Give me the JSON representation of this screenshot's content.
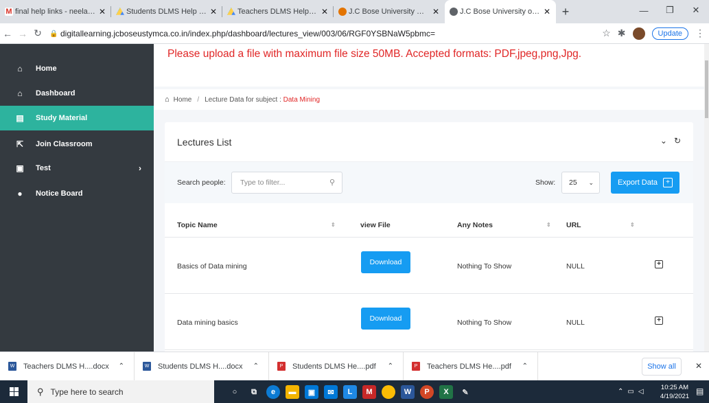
{
  "browser": {
    "tabs": [
      {
        "title": "final help links - neelam.du",
        "icon": "gmail-icon",
        "color": "#d93025"
      },
      {
        "title": "Students DLMS Help Book",
        "icon": "drive-icon",
        "color": "#1fa463"
      },
      {
        "title": "Teachers DLMS Help Book",
        "icon": "drive-icon",
        "color": "#1fa463"
      },
      {
        "title": "J.C Bose University Of Scien",
        "icon": "university-icon",
        "color": "#e37400"
      },
      {
        "title": "J.C Bose University of Scien",
        "icon": "globe-icon",
        "color": "#5f6368"
      }
    ],
    "url": "digitallearning.jcboseustymca.co.in/index.php/dashboard/lectures_view/003/06/RGF0YSBNaW5pbmc=",
    "update_label": "Update"
  },
  "sidebar": {
    "items": [
      {
        "label": "Home",
        "icon": "home-icon"
      },
      {
        "label": "Dashboard",
        "icon": "home-icon"
      },
      {
        "label": "Study Material",
        "icon": "book-icon",
        "active": true
      },
      {
        "label": "Join Classroom",
        "icon": "join-icon"
      },
      {
        "label": "Test",
        "icon": "test-icon",
        "caret": "›"
      },
      {
        "label": "Notice Board",
        "icon": "comment-icon"
      }
    ]
  },
  "main": {
    "notice": "Please upload a file with maximum file size 50MB. Accepted formats: PDF,jpeg,png,Jpg.",
    "breadcrumb": {
      "home": "Home",
      "separator": "/",
      "prefix": "Lecture Data for subject :",
      "subject": "Data Mining"
    },
    "card_title": "Lectures List",
    "search_label": "Search people:",
    "search_placeholder": "Type to filter...",
    "show_label": "Show:",
    "show_value": "25",
    "export_label": "Export Data",
    "table": {
      "headers": [
        "Topic Name",
        "view File",
        "Any Notes",
        "URL"
      ],
      "rows": [
        {
          "topic": "Basics of Data mining",
          "button": "Download",
          "notes": "Nothing To Show",
          "url": "NULL"
        },
        {
          "topic": "Data mining basics",
          "button": "Download",
          "notes": "Nothing To Show",
          "url": "NULL"
        }
      ]
    }
  },
  "downloads": {
    "items": [
      {
        "name": "Teachers DLMS H....docx",
        "type": "docx"
      },
      {
        "name": "Students DLMS H....docx",
        "type": "docx"
      },
      {
        "name": "Students DLMS He....pdf",
        "type": "pdf"
      },
      {
        "name": "Teachers DLMS He....pdf",
        "type": "pdf"
      }
    ],
    "show_all": "Show all"
  },
  "taskbar": {
    "search_placeholder": "Type here to search",
    "time": "10:25 AM",
    "date": "4/19/2021"
  }
}
